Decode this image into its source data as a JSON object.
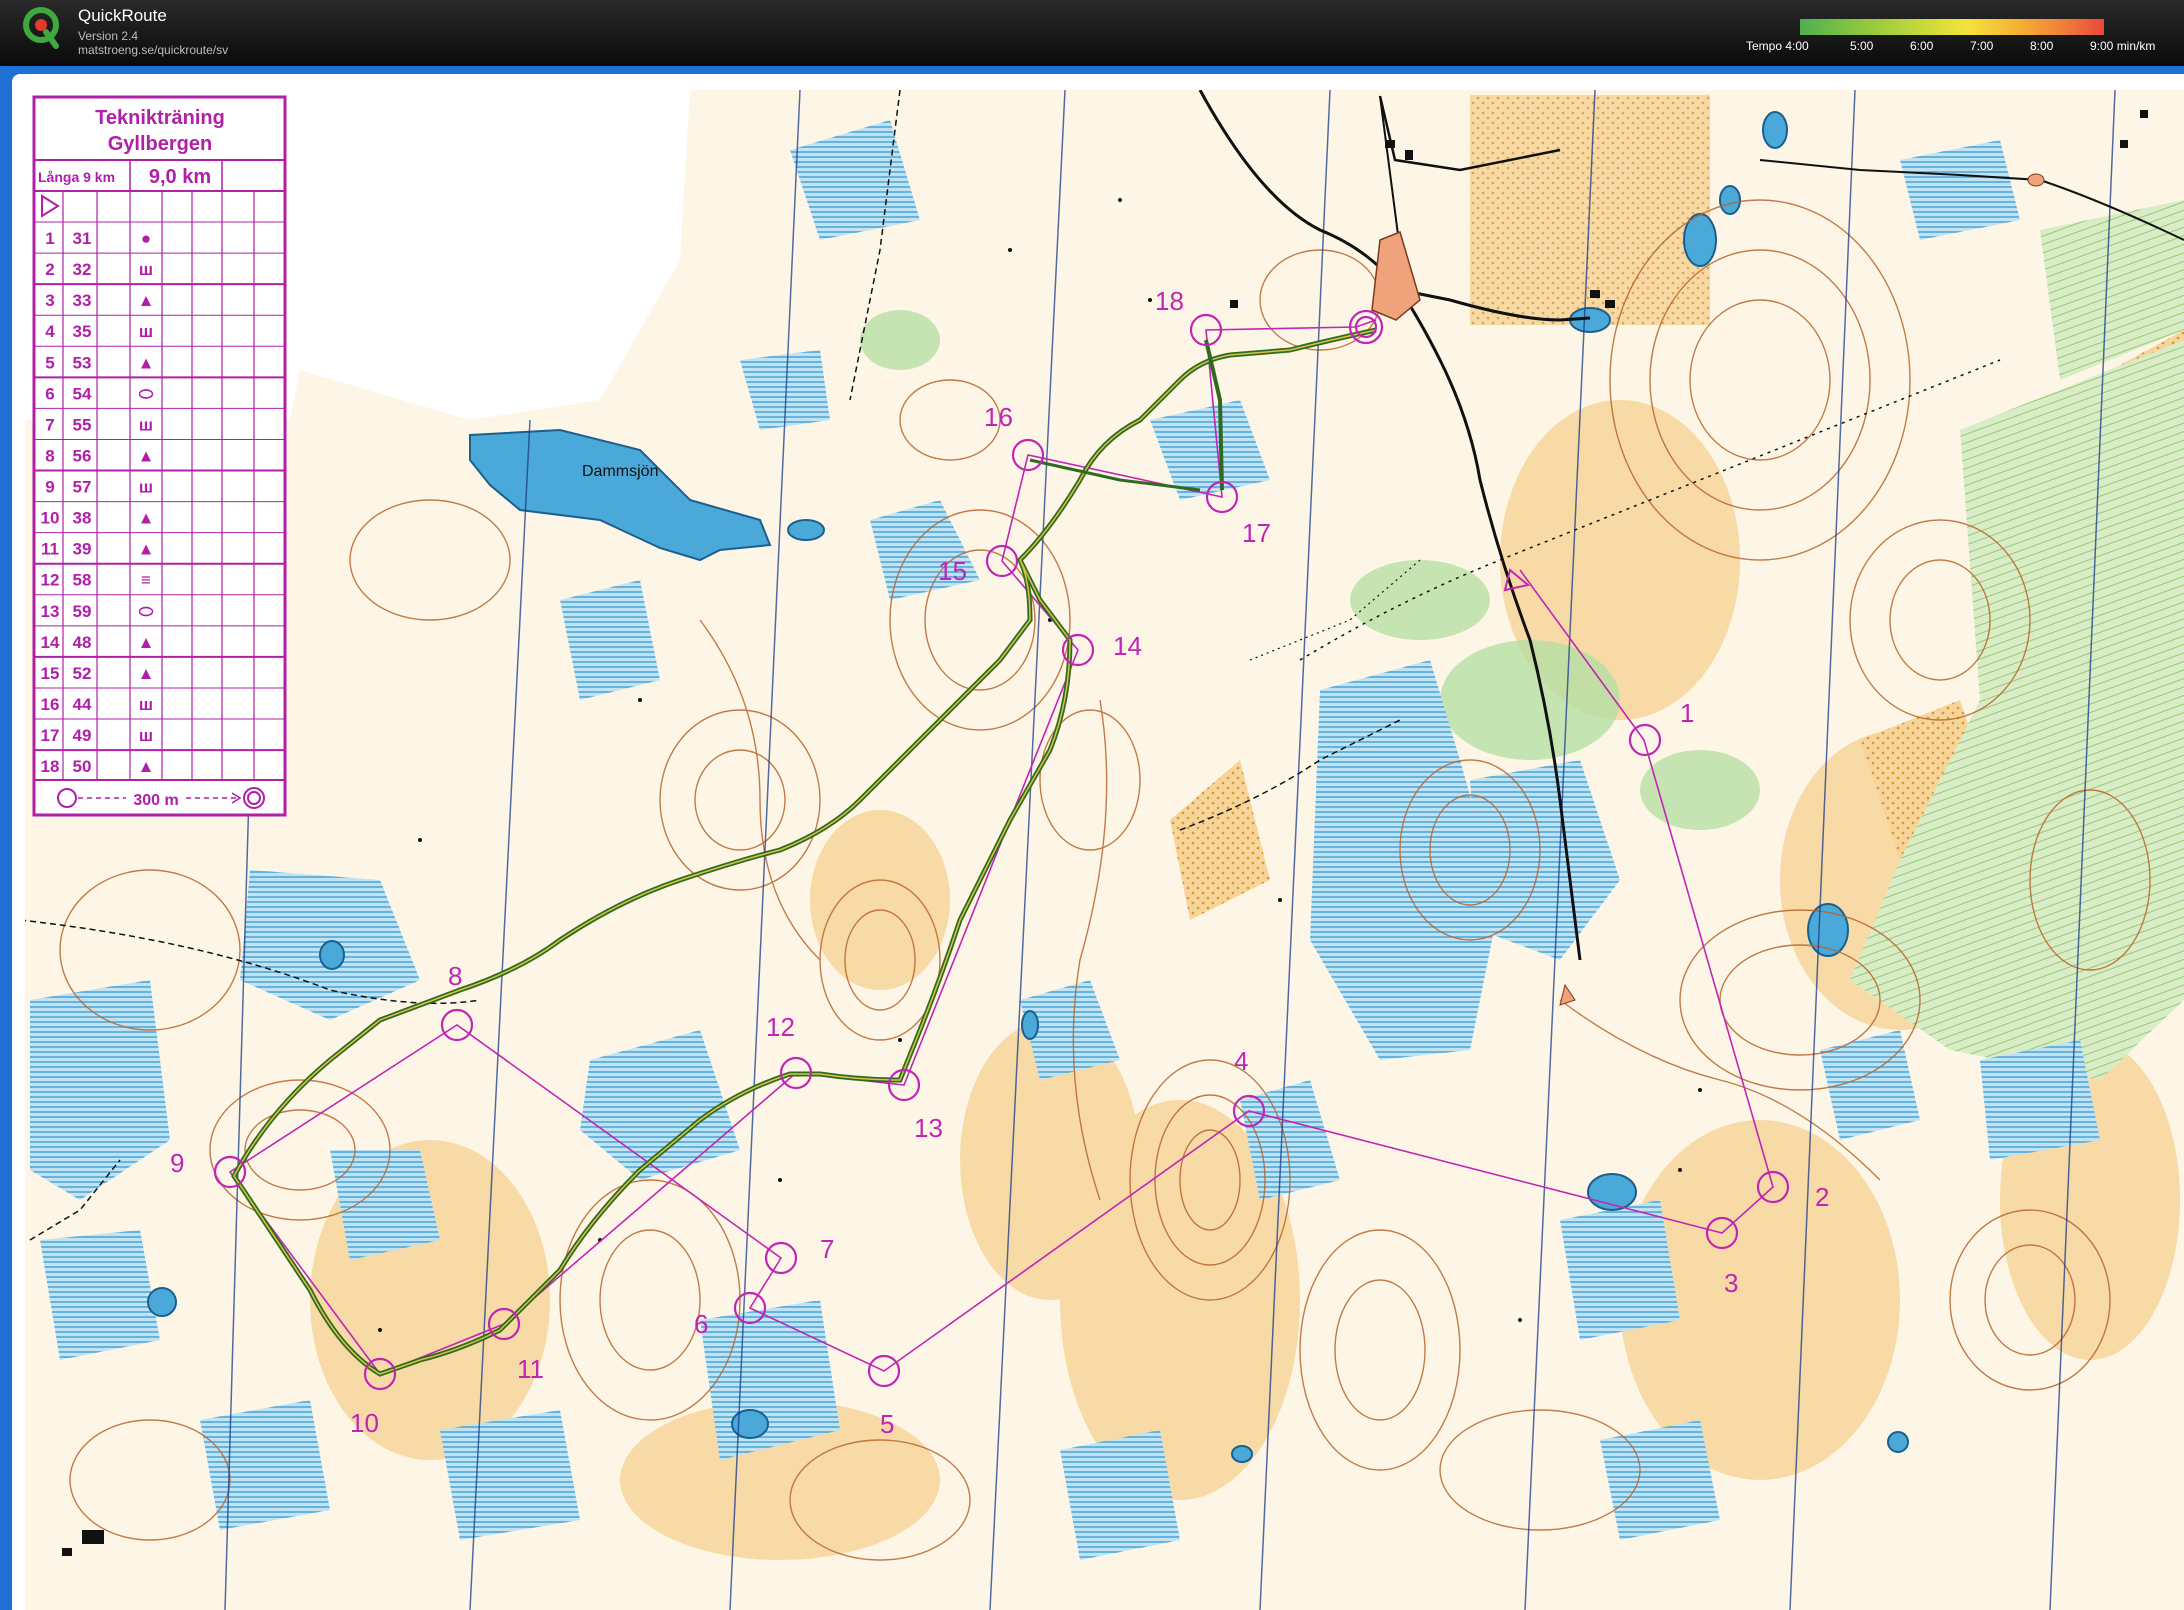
{
  "app": {
    "title": "QuickRoute",
    "version": "Version 2.4",
    "url": "matstroeng.se/quickroute/sv"
  },
  "pace_scale": {
    "labels": [
      "Tempo 4:00",
      "5:00",
      "6:00",
      "7:00",
      "8:00",
      "9:00  min/km"
    ],
    "colors": [
      "#4fb04f",
      "#8cc63f",
      "#f3e33a",
      "#f5b035",
      "#e8483c"
    ]
  },
  "map": {
    "lake_label": "Dammsjön",
    "course_color": "#c026b5",
    "route_color": "#2f6b1f",
    "water_color": "#4aa9d8",
    "contour_color": "#b8652d",
    "open_land_color": "#f4c678",
    "green_color": "#8fcf7f"
  },
  "control_card": {
    "title_line1": "Teknikträning",
    "title_line2": "Gyllbergen",
    "class": "Långa 9 km",
    "length": "9,0 km",
    "rows": [
      {
        "n": "1",
        "code": "31",
        "sym": "●"
      },
      {
        "n": "2",
        "code": "32",
        "sym": "ш"
      },
      {
        "n": "3",
        "code": "33",
        "sym": "▲"
      },
      {
        "n": "4",
        "code": "35",
        "sym": "ш"
      },
      {
        "n": "5",
        "code": "53",
        "sym": "▲"
      },
      {
        "n": "6",
        "code": "54",
        "sym": "⬭"
      },
      {
        "n": "7",
        "code": "55",
        "sym": "ш"
      },
      {
        "n": "8",
        "code": "56",
        "sym": "▲"
      },
      {
        "n": "9",
        "code": "57",
        "sym": "ш"
      },
      {
        "n": "10",
        "code": "38",
        "sym": "▲"
      },
      {
        "n": "11",
        "code": "39",
        "sym": "▲"
      },
      {
        "n": "12",
        "code": "58",
        "sym": "≡"
      },
      {
        "n": "13",
        "code": "59",
        "sym": "⬭"
      },
      {
        "n": "14",
        "code": "48",
        "sym": "▲"
      },
      {
        "n": "15",
        "code": "52",
        "sym": "▲"
      },
      {
        "n": "16",
        "code": "44",
        "sym": "ш"
      },
      {
        "n": "17",
        "code": "49",
        "sym": "ш"
      },
      {
        "n": "18",
        "code": "50",
        "sym": "▲"
      }
    ],
    "finish_distance": "300 m"
  },
  "controls": [
    {
      "label": "1"
    },
    {
      "label": "2"
    },
    {
      "label": "3"
    },
    {
      "label": "4"
    },
    {
      "label": "5"
    },
    {
      "label": "6"
    },
    {
      "label": "7"
    },
    {
      "label": "8"
    },
    {
      "label": "9"
    },
    {
      "label": "10"
    },
    {
      "label": "11"
    },
    {
      "label": "12"
    },
    {
      "label": "13"
    },
    {
      "label": "14"
    },
    {
      "label": "15"
    },
    {
      "label": "16"
    },
    {
      "label": "17"
    },
    {
      "label": "18"
    }
  ]
}
